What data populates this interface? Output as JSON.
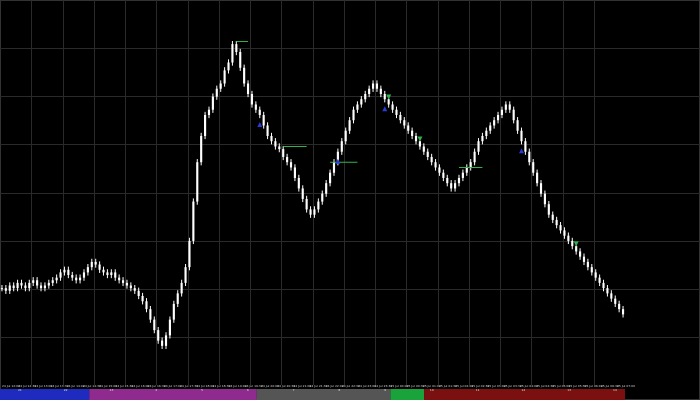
{
  "app": {
    "background_color": "#000000",
    "grid_color": "#2a2a2a",
    "border_color": "#333333"
  },
  "chart_data": {
    "type": "candlestick",
    "title": "",
    "grid": true,
    "candle_color": "#ffffff",
    "overlay_color": "#2fb34a",
    "arrow_up_color": "#2a3cd6",
    "arrow_down_color": "#2fb34a",
    "closes": [
      2,
      1,
      3,
      2,
      4,
      3,
      2,
      4,
      5,
      3,
      2,
      3,
      4,
      5,
      6,
      8,
      9,
      7,
      6,
      5,
      6,
      8,
      10,
      12,
      11,
      9,
      8,
      7,
      8,
      6,
      5,
      4,
      3,
      2,
      1,
      -1,
      -3,
      -6,
      -10,
      -14,
      -18,
      -20,
      -16,
      -10,
      -4,
      0,
      4,
      10,
      20,
      35,
      50,
      60,
      68,
      70,
      75,
      78,
      80,
      85,
      88,
      95,
      92,
      86,
      80,
      76,
      72,
      70,
      68,
      64,
      60,
      58,
      56,
      55,
      52,
      50,
      48,
      44,
      40,
      36,
      32,
      30,
      32,
      35,
      38,
      42,
      46,
      50,
      54,
      58,
      62,
      66,
      70,
      72,
      74,
      76,
      78,
      80,
      78,
      76,
      74,
      72,
      70,
      68,
      66,
      64,
      62,
      60,
      58,
      56,
      54,
      52,
      50,
      48,
      46,
      44,
      42,
      40,
      42,
      44,
      46,
      48,
      50,
      54,
      58,
      60,
      62,
      64,
      66,
      68,
      70,
      72,
      70,
      66,
      62,
      58,
      54,
      50,
      46,
      42,
      38,
      34,
      30,
      28,
      26,
      24,
      22,
      20,
      18,
      16,
      14,
      12,
      10,
      8,
      6,
      4,
      2,
      0,
      -2,
      -4,
      -6,
      -8
    ],
    "arrows_up_at": [
      66,
      86,
      98,
      133,
      168
    ],
    "arrows_down_at": [
      99,
      107,
      147
    ],
    "session_labels": [
      "21",
      "22",
      "23",
      "4",
      "5",
      "6",
      "7",
      "8",
      "9",
      "10",
      "11",
      "12",
      "13",
      "14"
    ],
    "time_labels": [
      "24 Jul 12:00",
      "24 Jul 12:30",
      "24 Jul 13:00",
      "24 Jul 13:30",
      "24 Jul 14:00",
      "24 Jul 14:30",
      "24 Jul 15:00",
      "24 Jul 15:30",
      "24 Jul 16:00",
      "24 Jul 16:30",
      "24 Jul 17:00",
      "24 Jul 17:30",
      "24 Jul 18:00",
      "24 Jul 18:30",
      "24 Jul 19:00",
      "24 Jul 19:30",
      "24 Jul 20:00",
      "24 Jul 20:30",
      "24 Jul 21:00",
      "24 Jul 21:30",
      "24 Jul 22:00",
      "24 Jul 22:30",
      "24 Jul 23:00",
      "24 Jul 23:30",
      "25 Jul 00:00",
      "25 Jul 00:30",
      "25 Jul 01:00",
      "25 Jul 01:30",
      "25 Jul 02:00",
      "25 Jul 02:30",
      "25 Jul 03:00",
      "25 Jul 03:30",
      "25 Jul 04:00",
      "25 Jul 04:30",
      "25 Jul 05:00",
      "25 Jul 05:30",
      "25 Jul 06:00",
      "25 Jul 06:30",
      "25 Jul 07:00"
    ],
    "session_segments": [
      {
        "color": "#1f2bbf",
        "units": 8
      },
      {
        "color": "#8f2a8f",
        "units": 15
      },
      {
        "color": "#555555",
        "units": 12
      },
      {
        "color": "#19a33a",
        "units": 3
      },
      {
        "color": "#7a1010",
        "units": 18
      }
    ]
  }
}
